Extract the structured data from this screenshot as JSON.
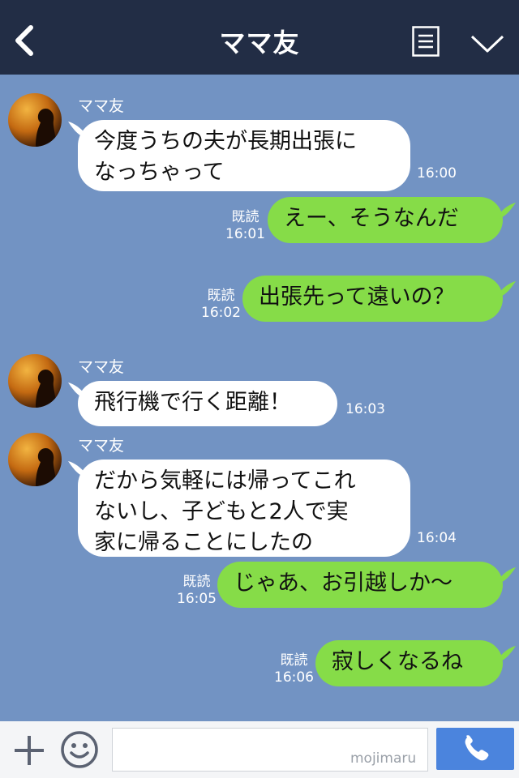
{
  "header": {
    "title": "ママ友"
  },
  "messages": [
    {
      "sender": "ママ友",
      "lines": [
        "今度うちの夫が長期出張に",
        "なっちゃって"
      ],
      "time": "16:00"
    },
    {
      "read": "既読",
      "text": "えー、そうなんだ",
      "time": "16:01"
    },
    {
      "read": "既読",
      "text": "出張先って遠いの？",
      "time": "16:02"
    },
    {
      "sender": "ママ友",
      "lines": [
        "飛行機で行く距離！"
      ],
      "time": "16:03"
    },
    {
      "sender": "ママ友",
      "lines": [
        "だから気軽には帰ってこれ",
        "ないし、子どもと2人で実",
        "家に帰ることにしたの"
      ],
      "time": "16:04"
    },
    {
      "read": "既読",
      "text": "じゃあ、お引越しか〜",
      "time": "16:05"
    },
    {
      "read": "既読",
      "text": "寂しくなるね",
      "time": "16:06"
    }
  ],
  "footer": {
    "watermark": "mojimaru"
  },
  "colors": {
    "background": "#7293c3",
    "header": "#222d45",
    "outgoing_bubble": "#86dc48",
    "incoming_bubble": "#ffffff",
    "call_button": "#4b84dd"
  },
  "icons": {
    "back": "chevron-left-icon",
    "menu": "menu-list-icon",
    "collapse": "chevron-down-icon",
    "add": "plus-icon",
    "sticker": "smiley-icon",
    "call": "phone-icon"
  }
}
